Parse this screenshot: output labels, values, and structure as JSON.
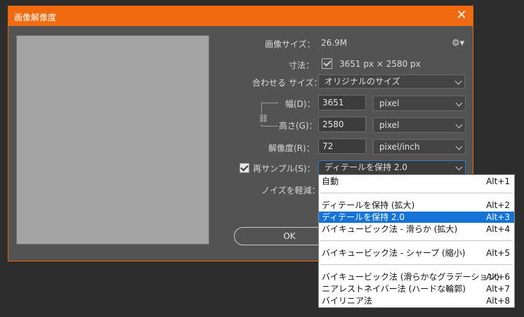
{
  "dialog": {
    "title": "画像解像度",
    "close_label": "✕",
    "settings_icon": "gear-icon"
  },
  "image_size": {
    "label": "画像サイズ：",
    "value": "26.9M"
  },
  "dimensions": {
    "label": "寸法：",
    "value": "3651 px × 2580 px"
  },
  "fit_to": {
    "label": "合わせる サイズ：",
    "value": "オリジナルのサイズ"
  },
  "width": {
    "label": "幅(D)：",
    "value": "3651",
    "unit": "pixel"
  },
  "height": {
    "label": "高さ(G)：",
    "value": "2580",
    "unit": "pixel"
  },
  "resolution": {
    "label": "解像度(R)：",
    "value": "72",
    "unit": "pixel/inch"
  },
  "resample": {
    "label": "再サンプル(S)：",
    "checked": true,
    "value": "ディテールを保持 2.0"
  },
  "noise": {
    "label": "ノイズを軽減："
  },
  "buttons": {
    "ok": "OK"
  },
  "dropdown": {
    "items": [
      {
        "label": "自動",
        "shortcut": "Alt+1"
      },
      {
        "label": "ディテールを保持 (拡大)",
        "shortcut": "Alt+2"
      },
      {
        "label": "ディテールを保持 2.0",
        "shortcut": "Alt+3",
        "selected": true
      },
      {
        "label": "バイキュービック法 - 滑らか (拡大)",
        "shortcut": "Alt+4"
      },
      {
        "label": "バイキュービック法 - シャープ (縮小)",
        "shortcut": "Alt+5"
      },
      {
        "label": "バイキュービック法 (滑らかなグラデーション)",
        "shortcut": "Alt+6"
      },
      {
        "label": "ニアレストネイバー法 (ハードな輪郭)",
        "shortcut": "Alt+7"
      },
      {
        "label": "バイリニア法",
        "shortcut": "Alt+8"
      }
    ]
  },
  "colors": {
    "titlebar": "#f06a0f",
    "dialog_bg": "#535353",
    "selection": "#1573d3"
  }
}
